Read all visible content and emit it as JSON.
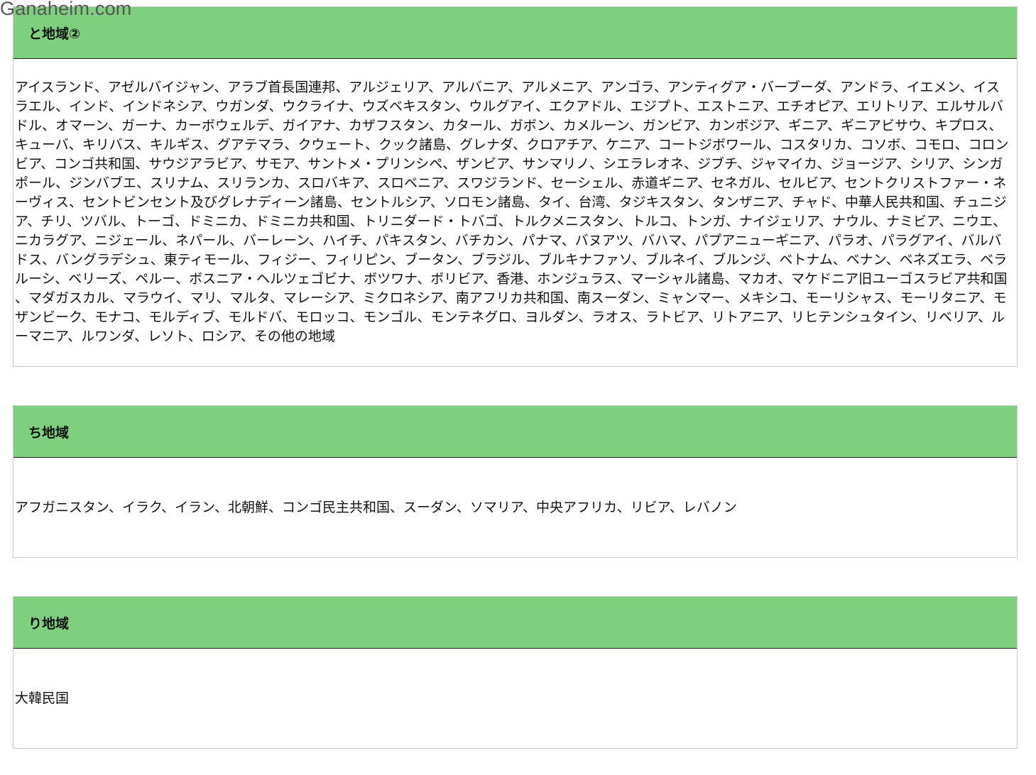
{
  "watermark": "Ganaheim.com",
  "regions": [
    {
      "title": "と地域②",
      "countries": "アイスランド、アゼルバイジャン、アラブ首長国連邦、アルジェリア、アルバニア、アルメニア、アンゴラ、アンティグア・バーブーダ、アンドラ、イエメン、イスラエル、インド、インドネシア、ウガンダ、ウクライナ、ウズベキスタン、ウルグアイ、エクアドル、エジプト、エストニア、エチオピア、エリトリア、エルサルバドル、オマーン、ガーナ、カーボウェルデ、ガイアナ、カザフスタン、カタール、ガボン、カメルーン、ガンビア、カンボジア、ギニア、ギニアビサウ、キプロス、キューバ、キリバス、キルギス、グアテマラ、クウェート、クック諸島、グレナダ、クロアチア、ケニア、コートジボワール、コスタリカ、コソボ、コモロ、コロンビア、コンゴ共和国、サウジアラビア、サモア、サントメ・プリンシペ、ザンビア、サンマリノ、シエラレオネ、ジブチ、ジャマイカ、ジョージア、シリア、シンガポール、ジンバブエ、スリナム、スリランカ、スロバキア、スロベニア、スワジランド、セーシェル、赤道ギニア、セネガル、セルビア、セントクリストファー・ネーヴィス、セントビンセント及びグレナディーン諸島、セントルシア、ソロモン諸島、タイ、台湾、タジキスタン、タンザニア、チャド、中華人民共和国、チュニジア、チリ、ツバル、トーゴ、ドミニカ、ドミニカ共和国、トリニダード・トバゴ、トルクメニスタン、トルコ、トンガ、ナイジェリア、ナウル、ナミビア、ニウエ、ニカラグア、ニジェール、ネパール、バーレーン、ハイチ、パキスタン、バチカン、パナマ、バヌアツ、バハマ、パプアニューギニア、パラオ、パラグアイ、バルバドス、バングラデシュ、東ティモール、フィジー、フィリピン、ブータン、ブラジル、ブルキナファソ、ブルネイ、ブルンジ、ベトナム、ベナン、ベネズエラ、ベラルーシ、ベリーズ、ペルー、ボスニア・ヘルツェゴビナ、ボツワナ、ボリビア、香港、ホンジュラス、マーシャル諸島、マカオ、マケドニア旧ユーゴスラビア共和国、マダガスカル、マラウイ、マリ、マルタ、マレーシア、ミクロネシア、南アフリカ共和国、南スーダン、ミャンマー、メキシコ、モーリシャス、モーリタニア、モザンビーク、モナコ、モルディブ、モルドバ、モロッコ、モンゴル、モンテネグロ、ヨルダン、ラオス、ラトビア、リトアニア、リヒテンシュタイン、リベリア、ルーマニア、ルワンダ、レソト、ロシア、その他の地域"
    },
    {
      "title": "ち地域",
      "countries": "アフガニスタン、イラク、イラン、北朝鮮、コンゴ民主共和国、スーダン、ソマリア、中央アフリカ、リビア、レバノン"
    },
    {
      "title": "り地域",
      "countries": "大韓民国"
    }
  ],
  "colors": {
    "header_bg": "#7ecf7e",
    "header_border": "#222222",
    "panel_border": "#c8c8c8",
    "text": "#111111",
    "watermark": "#555555"
  }
}
